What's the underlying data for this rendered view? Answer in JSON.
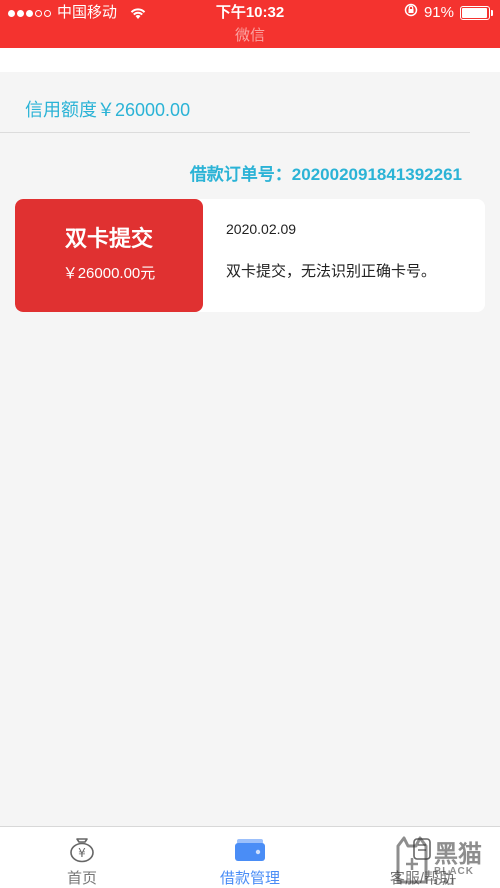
{
  "status_bar": {
    "carrier": "中国移动",
    "time": "下午10:32",
    "battery": "91%",
    "battery_level": 0.91
  },
  "header": {
    "title": "微信"
  },
  "credit": {
    "text": "信用额度￥26000.00"
  },
  "order": {
    "text": "借款订单号：202002091841392261"
  },
  "card": {
    "title": "双卡提交",
    "amount": "￥26000.00元",
    "date": "2020.02.09",
    "description": "双卡提交，无法识别正确卡号。"
  },
  "tabs": [
    {
      "label": "首页",
      "icon": "money-bag-icon"
    },
    {
      "label": "借款管理",
      "icon": "wallet-icon",
      "active": true
    },
    {
      "label": "客服/帮助",
      "icon": "help-icon"
    }
  ],
  "watermark": {
    "cn": "黑猫",
    "en": "BLACK CAT"
  },
  "colors": {
    "header_red": "#f4332f",
    "card_red": "#e03131",
    "accent_blue": "#2bb3d6",
    "tab_active": "#4a8df6"
  }
}
